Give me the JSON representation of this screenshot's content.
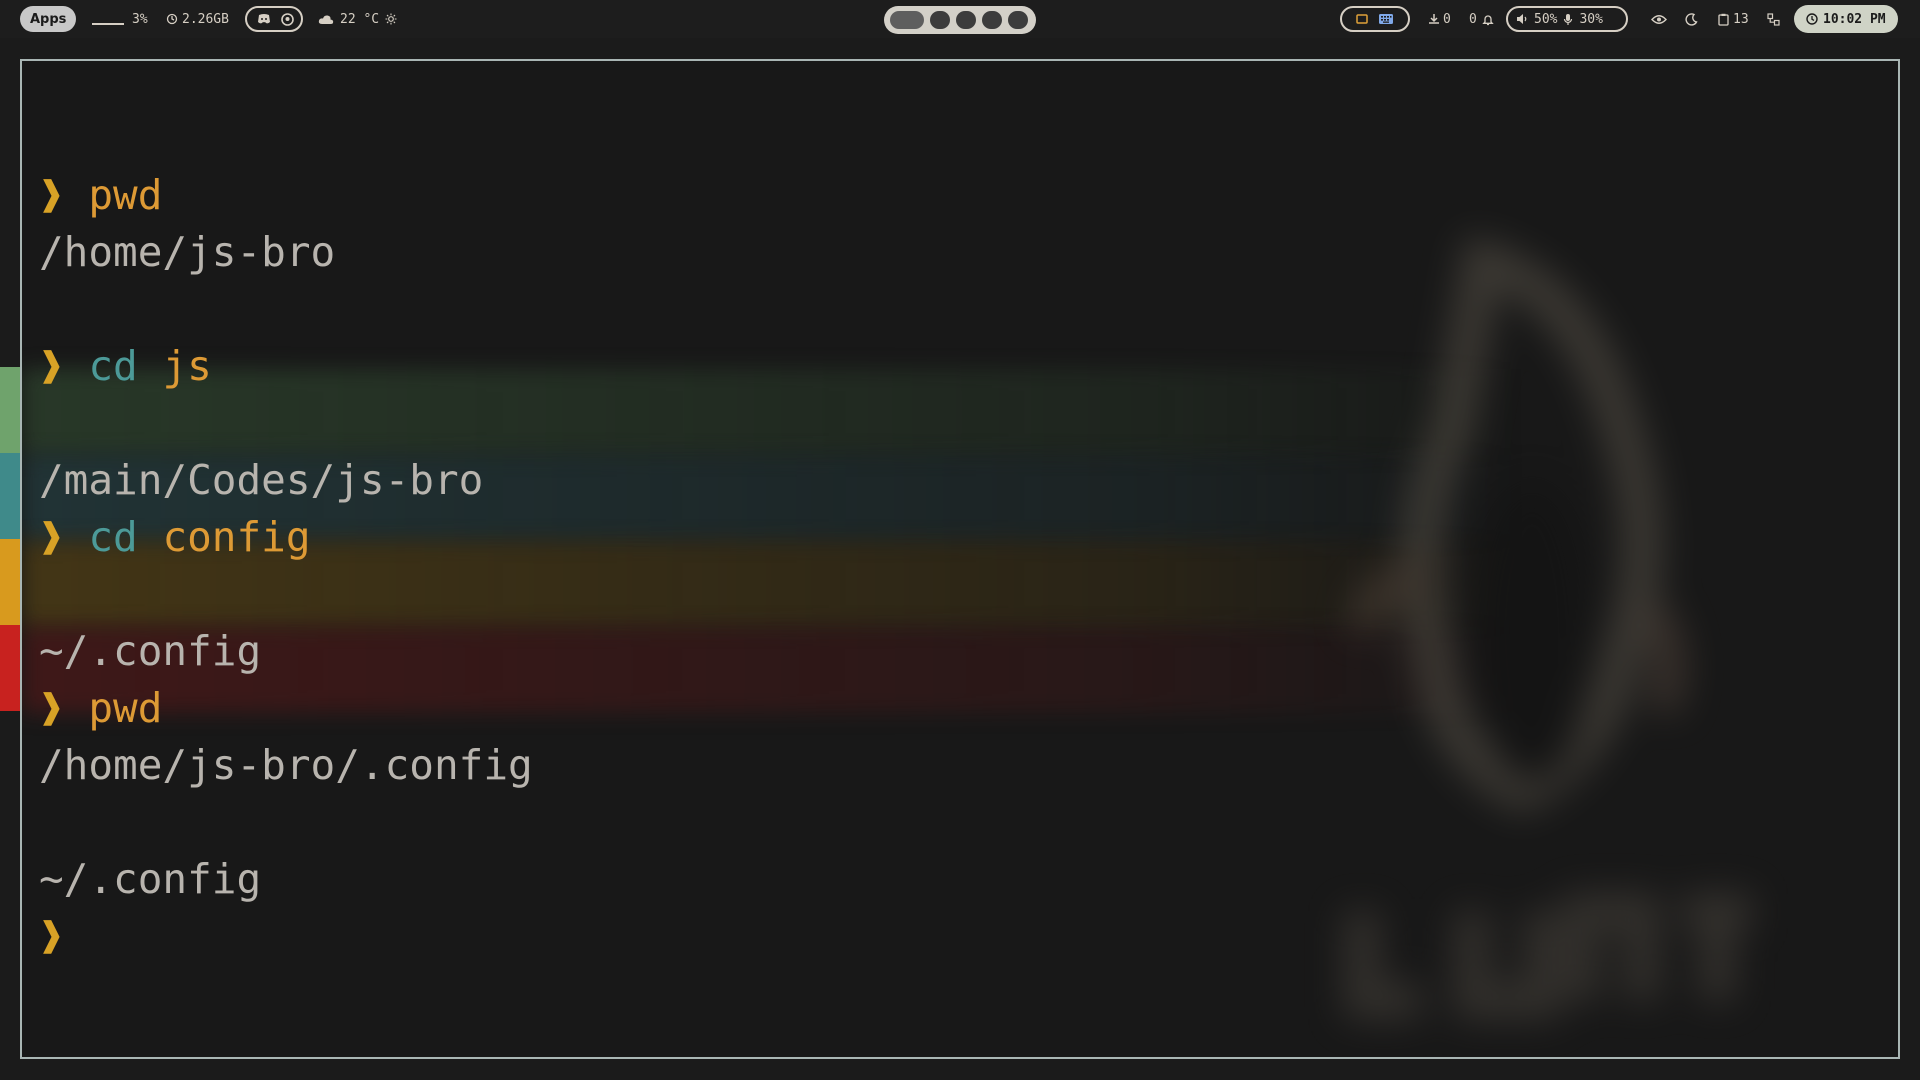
{
  "topbar": {
    "apps_label": "Apps",
    "cpu": "3%",
    "memory": "2.26GB",
    "weather": "22 °C",
    "downloads": "0",
    "notifications": "0",
    "volume": "50%",
    "mic": "30%",
    "clipboard": "13",
    "clock": "10:02 PM"
  },
  "terminal": {
    "lines": [
      {
        "prompt": "❱",
        "cmd": "pwd",
        "arg": ""
      },
      {
        "text": "/home/js-bro"
      },
      {
        "text": ""
      },
      {
        "prompt": "❱",
        "cmd": "cd",
        "arg": "js"
      },
      {
        "text": ""
      },
      {
        "text": "/main/Codes/js-bro"
      },
      {
        "prompt": "❱",
        "cmd": "cd",
        "arg": "config"
      },
      {
        "text": ""
      },
      {
        "text": "~/.config"
      },
      {
        "prompt": "❱",
        "cmd": "pwd",
        "arg": ""
      },
      {
        "text": "/home/js-bro/.config"
      },
      {
        "text": ""
      },
      {
        "text": "~/.config"
      },
      {
        "prompt": "❱",
        "cmd": "",
        "arg": ""
      }
    ]
  },
  "colors": {
    "accent_orange": "#d8a226",
    "builtin_teal": "#4c9a98",
    "stripe_green": "#6fa36c",
    "stripe_teal": "#3f8a8a",
    "stripe_orange": "#d89a1e",
    "stripe_red": "#c8221f"
  }
}
